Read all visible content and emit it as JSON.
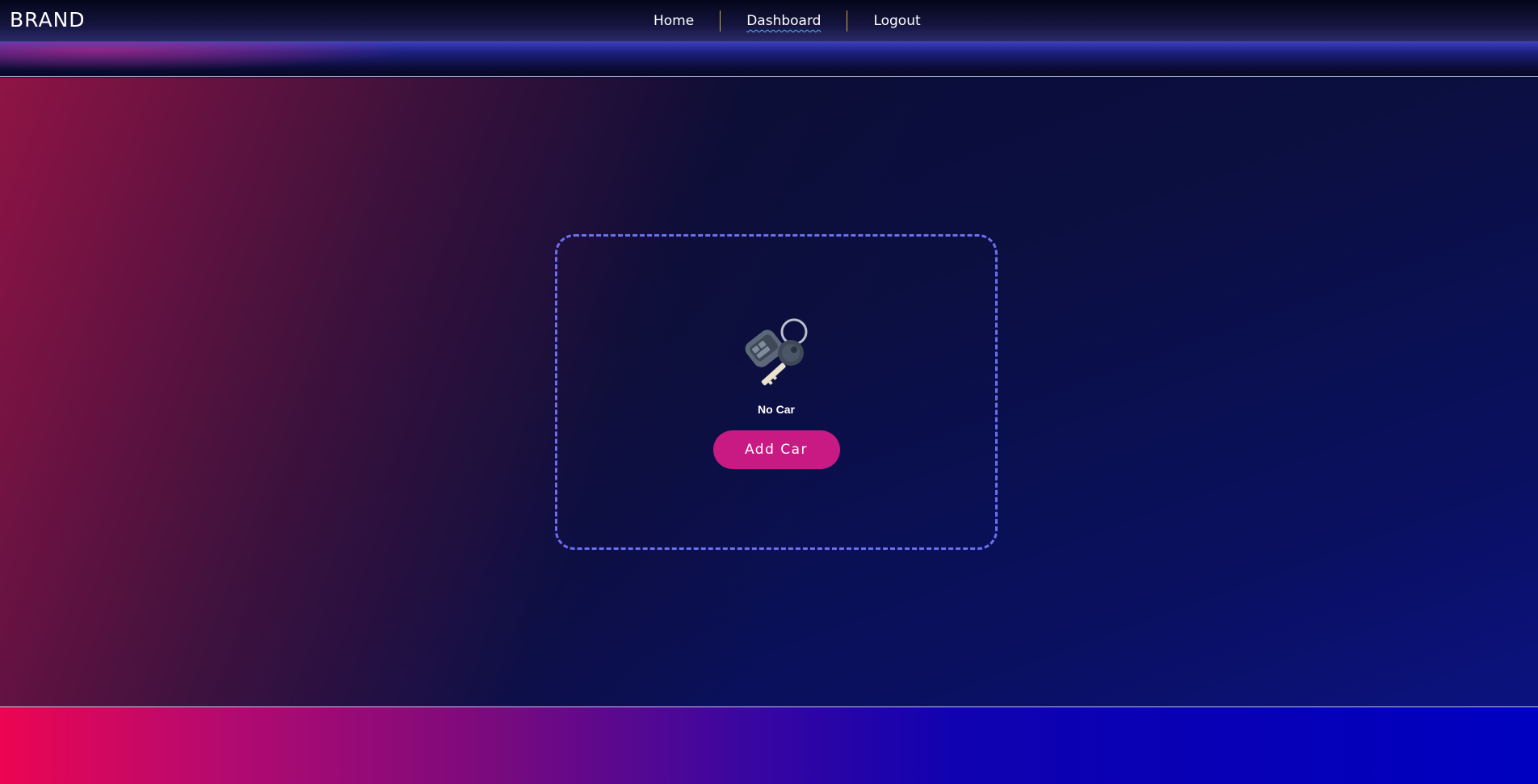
{
  "brand": {
    "name": "BRAND"
  },
  "nav": {
    "items": [
      {
        "label": "Home",
        "active": false
      },
      {
        "label": "Dashboard",
        "active": true
      },
      {
        "label": "Logout",
        "active": false
      }
    ]
  },
  "empty_state": {
    "icon": "car-keys-icon",
    "message": "No Car",
    "action_label": "Add Car"
  },
  "colors": {
    "accent_pink": "#c81a82",
    "dashed_border": "#6b6ff0",
    "active_underline": "#58b6ff",
    "nav_separator": "#c8b23a"
  }
}
